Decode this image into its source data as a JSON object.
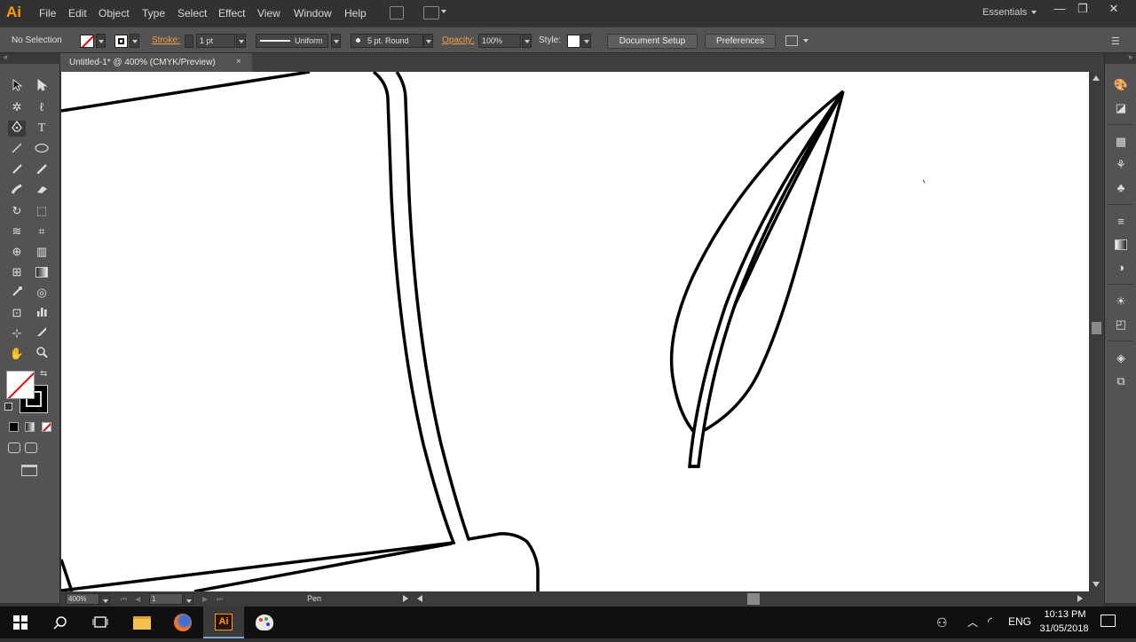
{
  "app": {
    "logo": "Ai",
    "workspace": "Essentials"
  },
  "menu": [
    "File",
    "Edit",
    "Object",
    "Type",
    "Select",
    "Effect",
    "View",
    "Window",
    "Help"
  ],
  "window_controls": {
    "minimize": "—",
    "restore": "❐",
    "close": "✕"
  },
  "control_bar": {
    "selection_status": "No Selection",
    "stroke_label": "Stroke:",
    "stroke_weight": "1 pt",
    "variable_width": "Uniform",
    "brush": "5 pt. Round",
    "opacity_label": "Opacity:",
    "opacity_value": "100%",
    "style_label": "Style:",
    "document_setup": "Document Setup",
    "preferences": "Preferences"
  },
  "document": {
    "tab_title": "Untitled-1* @ 400% (CMYK/Preview)",
    "close": "×"
  },
  "status_bar": {
    "zoom": "400%",
    "artboard": "1",
    "current_tool": "Pen"
  },
  "taskbar": {
    "language": "ENG",
    "time": "10:13 PM",
    "date": "31/05/2018"
  },
  "tools": {
    "selection": "selection-tool",
    "direct_selection": "direct-selection-tool",
    "magic_wand": "magic-wand-tool",
    "lasso": "lasso-tool",
    "pen": "pen-tool",
    "type": "type-tool",
    "line": "line-segment-tool",
    "ellipse": "ellipse-tool",
    "paintbrush": "paintbrush-tool",
    "pencil": "pencil-tool",
    "blob_brush": "blob-brush-tool",
    "eraser": "eraser-tool",
    "rotate": "rotate-tool",
    "scale": "scale-tool",
    "warp": "warp-tool",
    "free_transform": "free-transform-tool",
    "shape_builder": "shape-builder-tool",
    "perspective_grid": "perspective-grid-tool",
    "mesh": "mesh-tool",
    "gradient": "gradient-tool",
    "eyedropper": "eyedropper-tool",
    "blend": "blend-tool",
    "symbol_sprayer": "symbol-sprayer-tool",
    "column_graph": "column-graph-tool",
    "artboard": "artboard-tool",
    "slice": "slice-tool",
    "hand": "hand-tool",
    "zoom": "zoom-tool"
  },
  "colors": {
    "accent": "#ff9a00",
    "ui_dark": "#323232",
    "ui_mid": "#535353",
    "canvas": "#ffffff",
    "taskbar": "#101010"
  }
}
